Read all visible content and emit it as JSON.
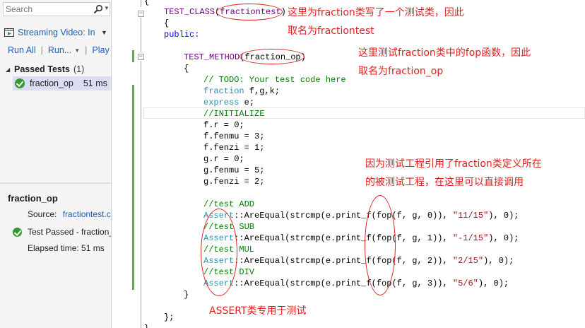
{
  "explorer": {
    "search_placeholder": "Search",
    "playlist_label": "Streaming Video: In",
    "run_all": "Run All",
    "run_menu": "Run...",
    "playlist_menu": "Play",
    "group_label": "Passed Tests",
    "group_count": "(1)",
    "test_name": "fraction_op",
    "test_time": "51 ms",
    "details": {
      "title": "fraction_op",
      "source_label": "Source:",
      "source_value": "fractiontest.cpp",
      "status": "Test Passed - fraction_op",
      "elapsed": "Elapsed time: 51 ms"
    }
  },
  "code": {
    "l00": "{",
    "l01_macro": "TEST_CLASS",
    "l01_name": "fractiontest",
    "l02": "{",
    "l03": "public:",
    "l04_macro": "TEST_METHOD",
    "l04_name": "fraction_op",
    "l05": "{",
    "l06": "// TODO: Your test code here",
    "l07_type": "fraction",
    "l07_rest": " f,g,k;",
    "l08_type": "express",
    "l08_rest": " e;",
    "l09": "//INITIALIZE",
    "l10": "f.r = 0;",
    "l11": "f.fenmu = 3;",
    "l12": "f.fenzi = 1;",
    "l13": "g.r = 0;",
    "l14": "g.fenmu = 5;",
    "l15": "g.fenzi = 2;",
    "l16": "//test ADD",
    "assert_kw": "Assert",
    "l17_mid": "::AreEqual(strcmp(e.print_f(fop(f, g, 0)), ",
    "l17_str": "\"11/15\"",
    "l18": "//test SUB",
    "l19_mid": "::AreEqual(strcmp(e.print_f(fop(f, g, 1)), ",
    "l19_str": "\"-1/15\"",
    "l20": "//test MUL",
    "l21_mid": "::AreEqual(strcmp(e.print_f(fop(f, g, 2)), ",
    "l21_str": "\"2/15\"",
    "l22": "//test DIV",
    "l23_mid": "::AreEqual(strcmp(e.print_f(fop(f, g, 3)), ",
    "l23_str": "\"5/6\"",
    "tail": "), 0);",
    "l24": "}",
    "l25": "};",
    "l26": "}"
  },
  "annotations": {
    "class_note_1": "这里为fraction类写了一个测试类，因此",
    "class_note_2": "取名为fractiontest",
    "method_note_1": "这里测试fraction类中的fop函数，因此",
    "method_note_2": "取名为fraction_op",
    "fop_note_1": "因为测试工程引用了fraction类定义所在",
    "fop_note_2": "的被测试工程，在这里可以直接调用",
    "assert_note": "ASSERT类专用于测试"
  },
  "colors": {
    "annotation": "#e02020",
    "keyword": "#0000ff",
    "comment": "#008000",
    "type": "#2b91af",
    "string": "#a31515",
    "macro": "#6f008a",
    "link": "#1e5fb4",
    "pass": "#339933",
    "change_bar": "#57b13f"
  },
  "icons": [
    "search-icon",
    "dropdown-icon",
    "playlist-icon",
    "chevron-down-icon",
    "expand-icon",
    "pass-icon",
    "fold-icon"
  ]
}
